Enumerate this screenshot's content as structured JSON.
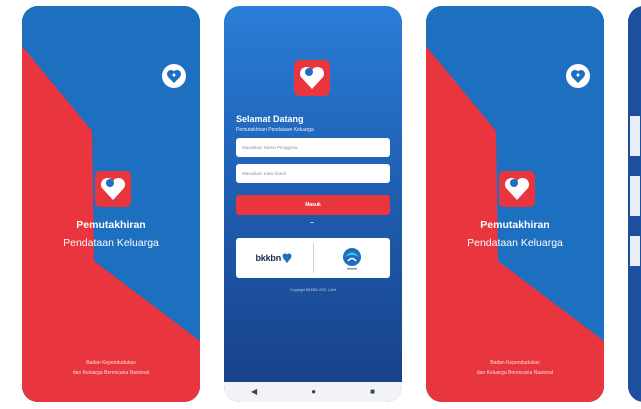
{
  "splash": {
    "title": "Pemutakhiran",
    "subtitle": "Pendataan Keluarga",
    "footer_line1": "Badan Kependudukan",
    "footer_line2": "dan Keluarga Berencana Nasional"
  },
  "login": {
    "greeting": "Selamat Datang",
    "subtitle": "Pemutakhiran Pendataan Keluarga",
    "username_placeholder": "Masukkan Nama Pengguna",
    "password_placeholder": "Masukkan Kata Sandi",
    "login_button": "Masuk",
    "partner_left": "bkkbn",
    "copyright": "Copyright BKKBN 2021 | Unit"
  },
  "nav": {
    "back_icon": "◀",
    "home_icon": "●",
    "recents_icon": "■"
  },
  "colors": {
    "blue": "#1d6fc0",
    "red": "#e8353e",
    "white": "#ffffff"
  },
  "icons": [
    "heart-logo-icon",
    "corner-logo-icon",
    "kominfo-logo-icon"
  ]
}
